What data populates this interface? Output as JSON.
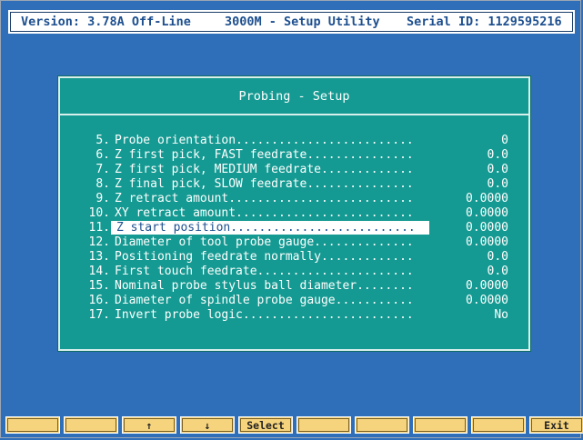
{
  "header": {
    "version": "Version: 3.78A Off-Line",
    "app": "3000M - Setup Utility",
    "serial": "Serial ID: 1129595216"
  },
  "panel": {
    "title": "Probing - Setup",
    "rows": [
      {
        "num": "5.",
        "label": "Probe orientation.........................",
        "value": "0"
      },
      {
        "num": "6.",
        "label": "Z first pick, FAST feedrate...............",
        "value": "0.0"
      },
      {
        "num": "7.",
        "label": "Z first pick, MEDIUM feedrate.............",
        "value": "0.0"
      },
      {
        "num": "8.",
        "label": "Z final pick, SLOW feedrate...............",
        "value": "0.0"
      },
      {
        "num": "9.",
        "label": "Z retract amount..........................",
        "value": "0.0000"
      },
      {
        "num": "10.",
        "label": "XY retract amount.........................",
        "value": "0.0000"
      },
      {
        "num": "11.",
        "label": "Z start position..........................",
        "value": "0.0000",
        "selected": true
      },
      {
        "num": "12.",
        "label": "Diameter of tool probe gauge..............",
        "value": "0.0000"
      },
      {
        "num": "13.",
        "label": "Positioning feedrate normally.............",
        "value": "0.0"
      },
      {
        "num": "14.",
        "label": "First touch feedrate......................",
        "value": "0.0"
      },
      {
        "num": "15.",
        "label": "Nominal probe stylus ball diameter........",
        "value": "0.0000"
      },
      {
        "num": "16.",
        "label": "Diameter of spindle probe gauge...........",
        "value": "0.0000"
      },
      {
        "num": "17.",
        "label": "Invert probe logic........................",
        "value": "No"
      }
    ]
  },
  "function_keys": [
    "",
    "",
    "↑",
    "↓",
    "Select",
    "",
    "",
    "",
    "",
    "Exit"
  ],
  "colors": {
    "background": "#2f6fba",
    "panel": "#149a92",
    "key": "#f6d47e",
    "text_blue": "#1d4f8f"
  }
}
